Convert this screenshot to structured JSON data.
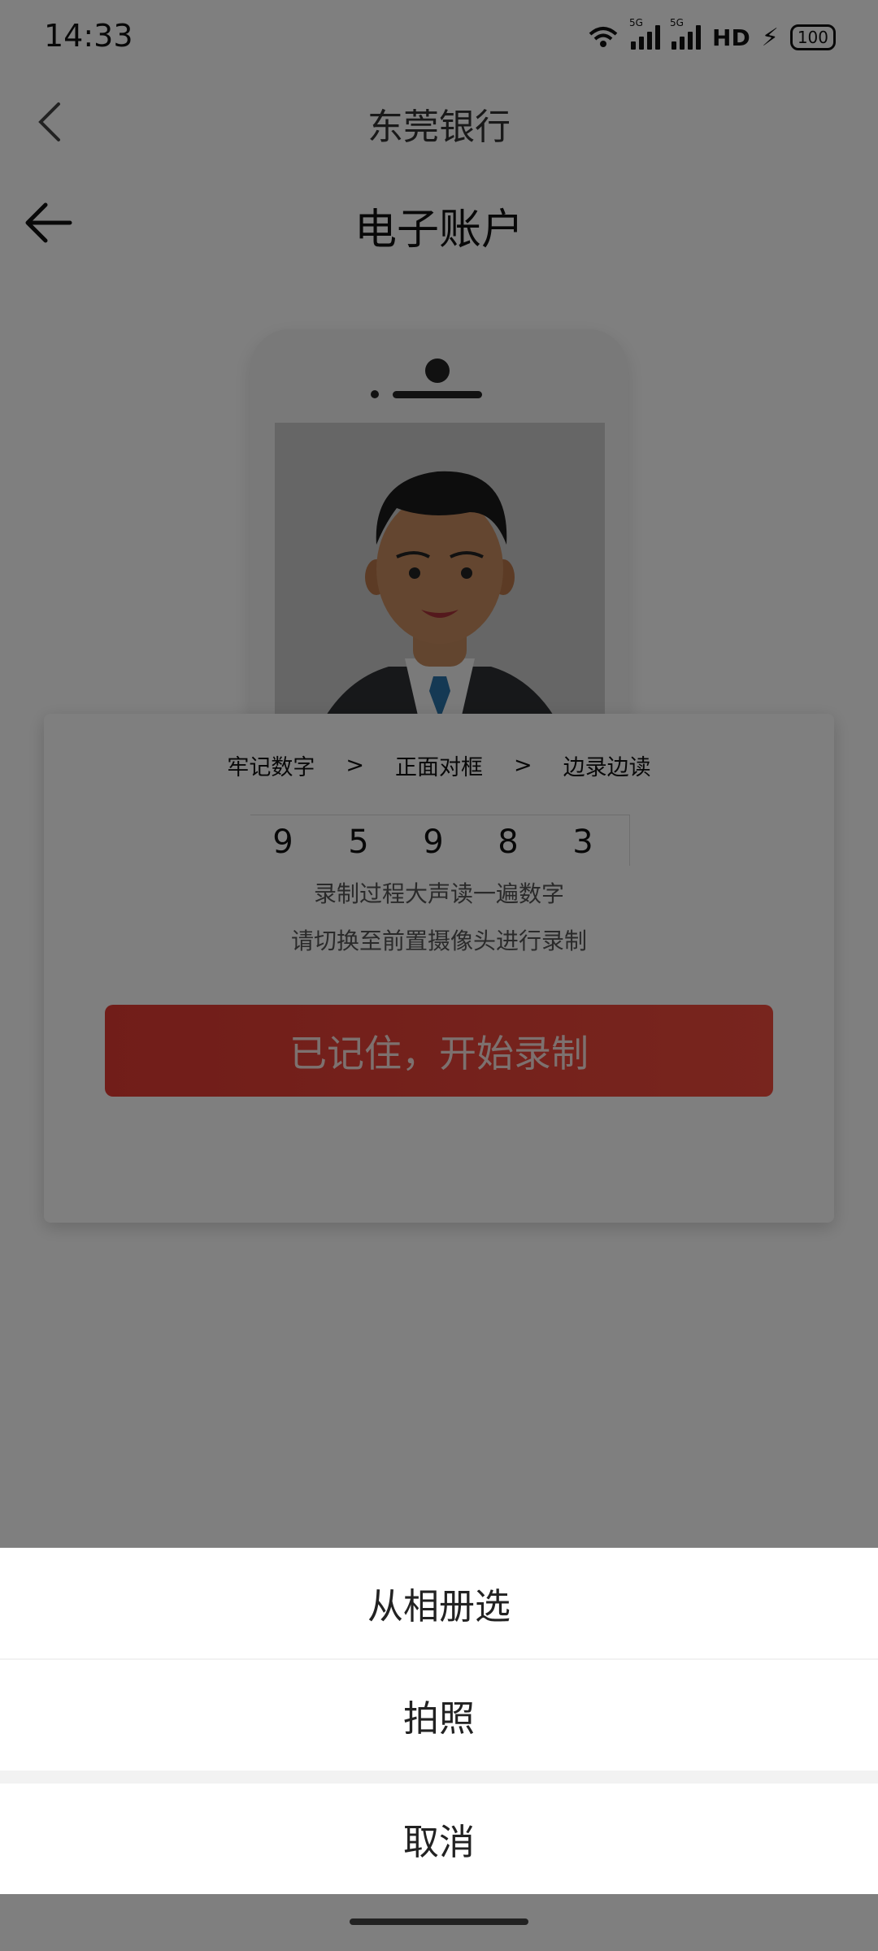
{
  "status_bar": {
    "time": "14:33",
    "signal_tag_1": "5G",
    "signal_tag_2": "5G",
    "hd_label": "HD",
    "battery": "100"
  },
  "header": {
    "app_title": "东莞银行",
    "page_title": "电子账户"
  },
  "card": {
    "steps": [
      "牢记数字",
      "正面对框",
      "边录边读"
    ],
    "step_separator": ">",
    "digits": [
      "9",
      "5",
      "9",
      "8",
      "3"
    ],
    "hint_read": "录制过程大声读一遍数字",
    "hint_camera": "请切换至前置摄像头进行录制",
    "record_button": "已记住，开始录制"
  },
  "action_sheet": {
    "choose_album": "从相册选",
    "take_photo": "拍照",
    "cancel": "取消"
  },
  "icons": {
    "back_top": "chevron-left-icon",
    "back_main": "arrow-left-icon",
    "wifi": "wifi-icon",
    "charging": "bolt-icon"
  },
  "colors": {
    "brand_red": "#e33b33",
    "overlay": "rgba(0,0,0,0.5)"
  }
}
